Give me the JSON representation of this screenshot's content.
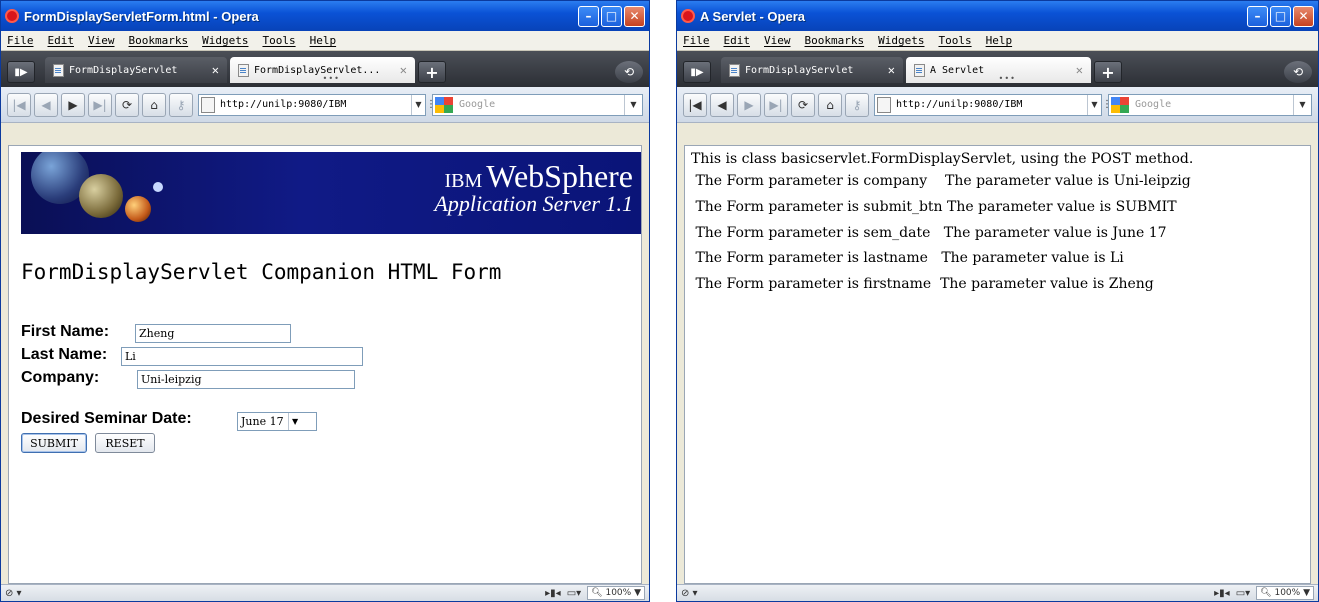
{
  "menu": [
    "File",
    "Edit",
    "View",
    "Bookmarks",
    "Widgets",
    "Tools",
    "Help"
  ],
  "left_window": {
    "title": "FormDisplayServletForm.html - Opera",
    "tabs": [
      {
        "label": "FormDisplayServlet",
        "active": false
      },
      {
        "label": "FormDisplayServlet...",
        "active": true
      }
    ],
    "url": "http://unilp:9080/IBM",
    "search_placeholder": "Google",
    "banner": {
      "brand": "IBM",
      "product": "WebSphere",
      "subtitle": "Application Server 1.1"
    },
    "heading": "FormDisplayServlet Companion HTML Form",
    "form": {
      "first_name_label": "First Name:",
      "first_name_value": "Zheng",
      "last_name_label": "Last Name:",
      "last_name_value": "Li",
      "company_label": "Company:",
      "company_value": "Uni-leipzig",
      "seminar_label": "Desired Seminar Date:",
      "seminar_value": "June 17",
      "submit_label": "SUBMIT",
      "reset_label": "RESET"
    },
    "zoom": "100%"
  },
  "right_window": {
    "title": "A Servlet - Opera",
    "tabs": [
      {
        "label": "FormDisplayServlet",
        "active": false
      },
      {
        "label": "A Servlet",
        "active": true
      }
    ],
    "url": "http://unilp:9080/IBM",
    "search_placeholder": "Google",
    "lines": [
      "This is class basicservlet.FormDisplayServlet, using the POST method.",
      " The Form parameter is company    The parameter value is Uni-leipzig",
      " The Form parameter is submit_btn The parameter value is SUBMIT",
      " The Form parameter is sem_date   The parameter value is June 17",
      " The Form parameter is lastname   The parameter value is Li",
      " The Form parameter is firstname  The parameter value is Zheng"
    ],
    "zoom": "100%"
  },
  "icons": {
    "opera": "opera-logo-icon",
    "back": "rewind-icon",
    "prev": "back-arrow-icon",
    "next": "forward-arrow-icon",
    "ff": "fast-forward-icon",
    "reload": "reload-icon",
    "home": "home-icon",
    "security": "key-icon"
  },
  "colors": {
    "titlebar": "#0a52d6",
    "banner": "#101a86",
    "tabbar": "#2c2f35"
  }
}
